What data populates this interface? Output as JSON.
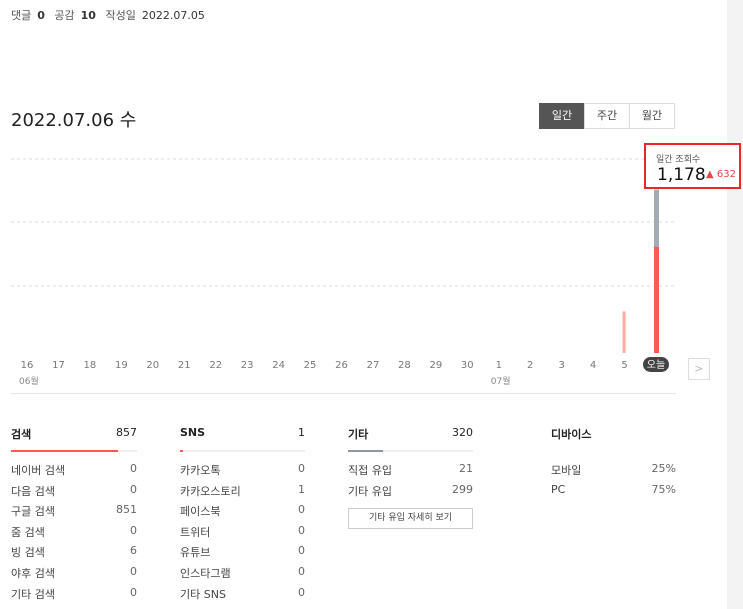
{
  "meta": {
    "comments_label": "댓글",
    "comments": "0",
    "likes_label": "공감",
    "likes": "10",
    "created_label": "작성일",
    "created": "2022.07.05"
  },
  "date_title": "2022.07.06 수",
  "range_tabs": [
    {
      "label": "일간",
      "active": true
    },
    {
      "label": "주간",
      "active": false
    },
    {
      "label": "월간",
      "active": false
    }
  ],
  "tooltip": {
    "label": "일간 조회수",
    "value": "1,178",
    "delta": "632"
  },
  "chart_data": {
    "type": "bar",
    "categories": [
      "16",
      "17",
      "18",
      "19",
      "20",
      "21",
      "22",
      "23",
      "24",
      "25",
      "26",
      "27",
      "28",
      "29",
      "30",
      "1",
      "2",
      "3",
      "4",
      "5",
      "오늘"
    ],
    "month_labels": [
      {
        "label": "06월",
        "at": "16"
      },
      {
        "label": "07월",
        "at": "1"
      }
    ],
    "series": [
      {
        "values": [
          0,
          0,
          0,
          0,
          0,
          0,
          0,
          0,
          0,
          0,
          0,
          0,
          0,
          0,
          0,
          0,
          0,
          0,
          0,
          300,
          1178
        ],
        "color": "#ff5a4f",
        "part": "top_new"
      },
      {
        "values": [
          0,
          0,
          0,
          0,
          0,
          0,
          0,
          0,
          0,
          0,
          0,
          0,
          0,
          0,
          0,
          0,
          0,
          0,
          0,
          546,
          546
        ],
        "color": "#a3acb3",
        "part": "prev"
      }
    ],
    "ylim": [
      0,
      1400
    ],
    "grid": true
  },
  "stats": {
    "search": {
      "title": "검색",
      "count": "857",
      "progress": 0.85,
      "color": "#ff5a4f",
      "rows": [
        [
          "네이버 검색",
          "0"
        ],
        [
          "다음 검색",
          "0"
        ],
        [
          "구글 검색",
          "851"
        ],
        [
          "줌 검색",
          "0"
        ],
        [
          "빙 검색",
          "6"
        ],
        [
          "야후 검색",
          "0"
        ],
        [
          "기타 검색",
          "0"
        ]
      ]
    },
    "sns": {
      "title": "SNS",
      "count": "1",
      "progress": 0.01,
      "color": "#ff5a4f",
      "rows": [
        [
          "카카오톡",
          "0"
        ],
        [
          "카카오스토리",
          "1"
        ],
        [
          "페이스북",
          "0"
        ],
        [
          "트위터",
          "0"
        ],
        [
          "유튜브",
          "0"
        ],
        [
          "인스타그램",
          "0"
        ],
        [
          "기타 SNS",
          "0"
        ]
      ]
    },
    "etc": {
      "title": "기타",
      "count": "320",
      "progress": 0.28,
      "color": "#8a98a3",
      "rows": [
        [
          "직접 유입",
          "21"
        ],
        [
          "기타 유입",
          "299"
        ]
      ],
      "more_label": "기타 유입 자세히 보기"
    },
    "device": {
      "title": "디바이스",
      "rows": [
        [
          "모바일",
          "25%"
        ],
        [
          "PC",
          "75%"
        ]
      ]
    }
  }
}
